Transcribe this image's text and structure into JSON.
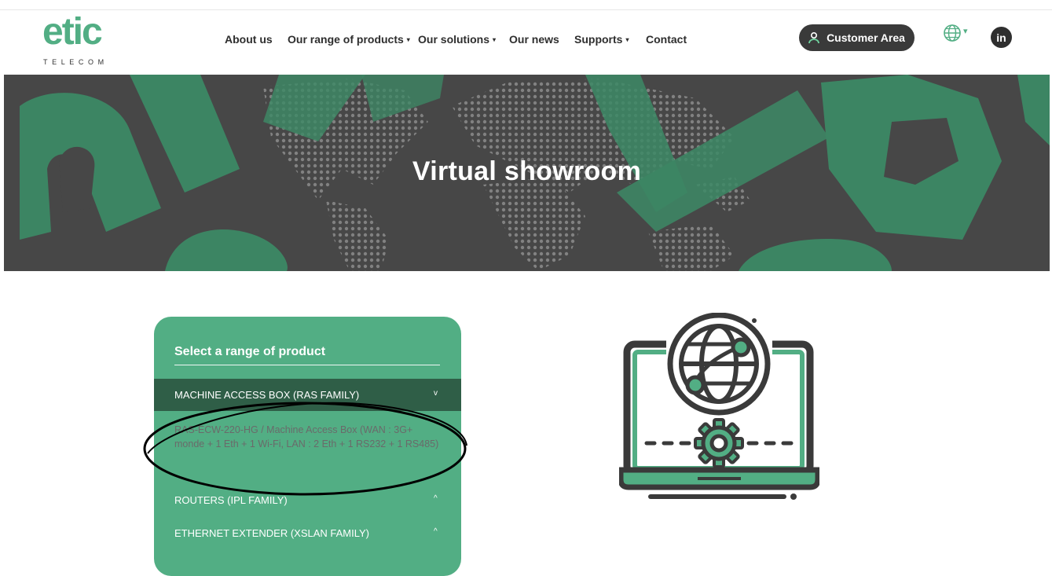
{
  "brand": {
    "logo_text": "etic",
    "logo_subtext": "TELECOM",
    "accent": "#52ae84",
    "dark": "#3a3a3a"
  },
  "nav": {
    "items": [
      {
        "label": "About us",
        "dropdown": false
      },
      {
        "label": "Our range of products",
        "dropdown": true
      },
      {
        "label": "Our solutions",
        "dropdown": true
      },
      {
        "label": "Our news",
        "dropdown": false
      },
      {
        "label": "Supports",
        "dropdown": true
      },
      {
        "label": "Contact",
        "dropdown": false
      }
    ],
    "caret": "▾"
  },
  "header_actions": {
    "customer_area": "Customer Area",
    "customer_icon": "user-icon",
    "language_icon": "globe-icon",
    "language_caret": "▾",
    "social": "in"
  },
  "hero": {
    "title": "Virtual showroom"
  },
  "selector": {
    "title": "Select a range of product",
    "groups": [
      {
        "label": "MACHINE ACCESS BOX (RAS FAMILY)",
        "arrow": "v",
        "expanded": true
      },
      {
        "label": "ROUTERS (IPL FAMILY)",
        "arrow": "^",
        "expanded": false
      },
      {
        "label": "ETHERNET EXTENDER (XSLAN FAMILY)",
        "arrow": "^",
        "expanded": false
      }
    ],
    "expanded_item": "RAS-ECW-220-HG / Machine Access Box (WAN : 3G+ monde + 1 Eth + 1 Wi-Fi, LAN : 2 Eth + 1 RS232 + 1 RS485)"
  },
  "illustration": {
    "icon": "laptop-globe-gear-icon"
  }
}
